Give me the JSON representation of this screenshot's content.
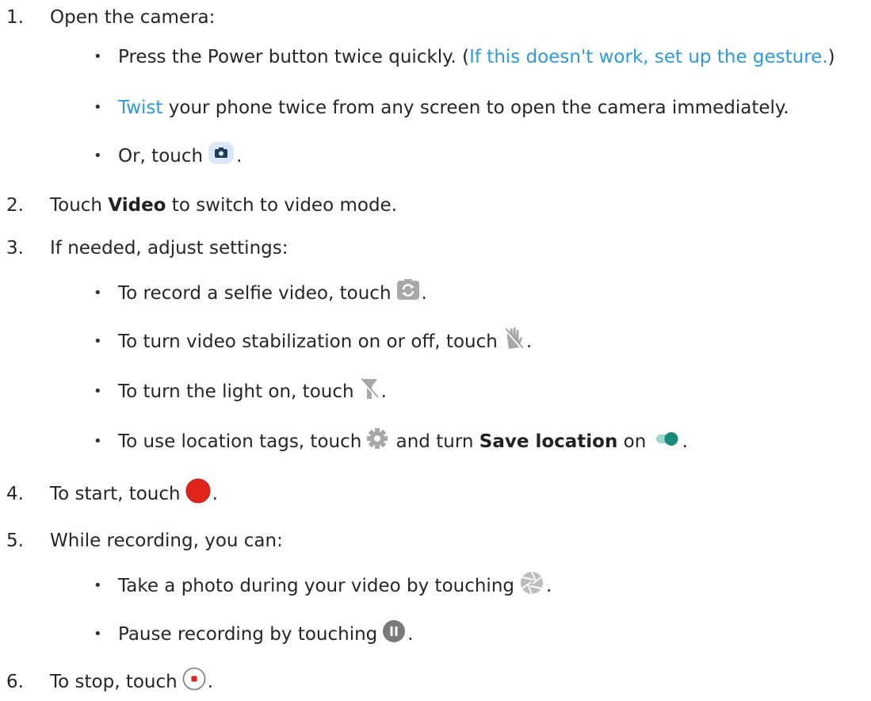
{
  "steps": [
    {
      "num": "1.",
      "text": "Open the camera:"
    },
    {
      "num": "2.",
      "pre": "Touch ",
      "bold": "Video",
      "post": " to switch to video mode."
    },
    {
      "num": "3.",
      "text": "If needed, adjust settings:"
    },
    {
      "num": "4.",
      "pre": "To start, touch ",
      "post": "."
    },
    {
      "num": "5.",
      "text": "While recording, you can:"
    },
    {
      "num": "6.",
      "pre": "To stop, touch ",
      "post": "."
    }
  ],
  "step1_bullets": {
    "power": {
      "text": "Press the Power button twice quickly. (",
      "link": "If this doesn't work, set up the gesture.",
      "close": ")"
    },
    "twist": {
      "link": "Twist",
      "text": " your phone twice from any screen to open the camera immediately."
    },
    "touch": {
      "pre": "Or, touch ",
      "post": "."
    }
  },
  "step3_bullets": [
    {
      "pre": "To record a selfie video, touch ",
      "post": ".",
      "icon": "switch-camera-icon"
    },
    {
      "pre": "To turn video stabilization on or off, touch ",
      "post": ".",
      "icon": "stabilization-off-icon"
    },
    {
      "pre": "To turn the light on, touch ",
      "post": ".",
      "icon": "flashlight-off-icon"
    },
    {
      "pre": "To use location tags, touch ",
      "mid": " and turn ",
      "bold": "Save location",
      "on": " on ",
      "post": ".",
      "icon": "gear-icon"
    }
  ],
  "step5_bullets": [
    {
      "pre": "Take a photo during your video by touching ",
      "post": ".",
      "icon": "shutter-icon"
    },
    {
      "pre": "Pause recording by touching ",
      "post": ".",
      "icon": "pause-icon"
    }
  ],
  "bullet_char": "•",
  "colors": {
    "link": "#2b9ae0",
    "record": "#e0241b",
    "toggle": "#1a8a79"
  }
}
